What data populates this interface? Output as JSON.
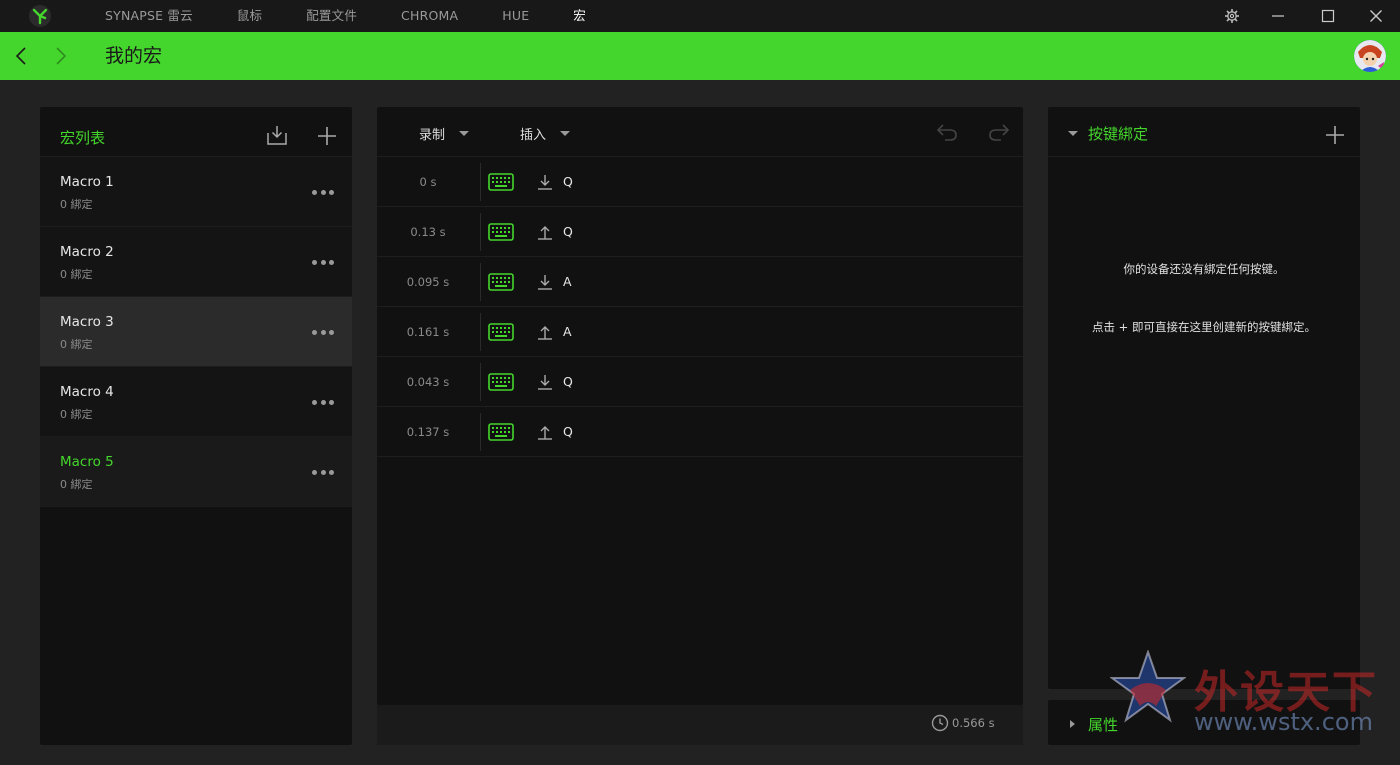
{
  "titlebar": {
    "tabs": [
      {
        "label": "SYNAPSE 雷云"
      },
      {
        "label": "鼠标"
      },
      {
        "label": "配置文件"
      },
      {
        "label": "CHROMA"
      },
      {
        "label": "HUE"
      },
      {
        "label": "宏"
      }
    ],
    "active_tab": "宏"
  },
  "header": {
    "title": "我的宏"
  },
  "macro_list": {
    "title": "宏列表",
    "items": [
      {
        "name": "Macro 1",
        "bindings": "0 綁定"
      },
      {
        "name": "Macro 2",
        "bindings": "0 綁定"
      },
      {
        "name": "Macro 3",
        "bindings": "0 綁定"
      },
      {
        "name": "Macro 4",
        "bindings": "0 綁定"
      },
      {
        "name": "Macro 5",
        "bindings": "0 綁定"
      }
    ],
    "hovered_index": 2,
    "selected_index": 4
  },
  "editor": {
    "record_label": "录制",
    "insert_label": "插入",
    "events": [
      {
        "delay": "0 s",
        "direction": "down",
        "key": "Q"
      },
      {
        "delay": "0.13 s",
        "direction": "up",
        "key": "Q"
      },
      {
        "delay": "0.095 s",
        "direction": "down",
        "key": "A"
      },
      {
        "delay": "0.161 s",
        "direction": "up",
        "key": "A"
      },
      {
        "delay": "0.043 s",
        "direction": "down",
        "key": "Q"
      },
      {
        "delay": "0.137 s",
        "direction": "up",
        "key": "Q"
      }
    ],
    "total_time": "0.566 s"
  },
  "binding": {
    "title": "按键綁定",
    "empty_line1": "你的设备还没有綁定任何按键。",
    "empty_line2": "点击 + 即可直接在这里创建新的按键綁定。"
  },
  "properties": {
    "title": "属性"
  },
  "watermark": {
    "brand": "外设天下",
    "url": "www.wstx.com"
  },
  "colors": {
    "accent": "#44d62c",
    "background": "#222222",
    "panel": "#111111",
    "titlebar": "#181818"
  }
}
